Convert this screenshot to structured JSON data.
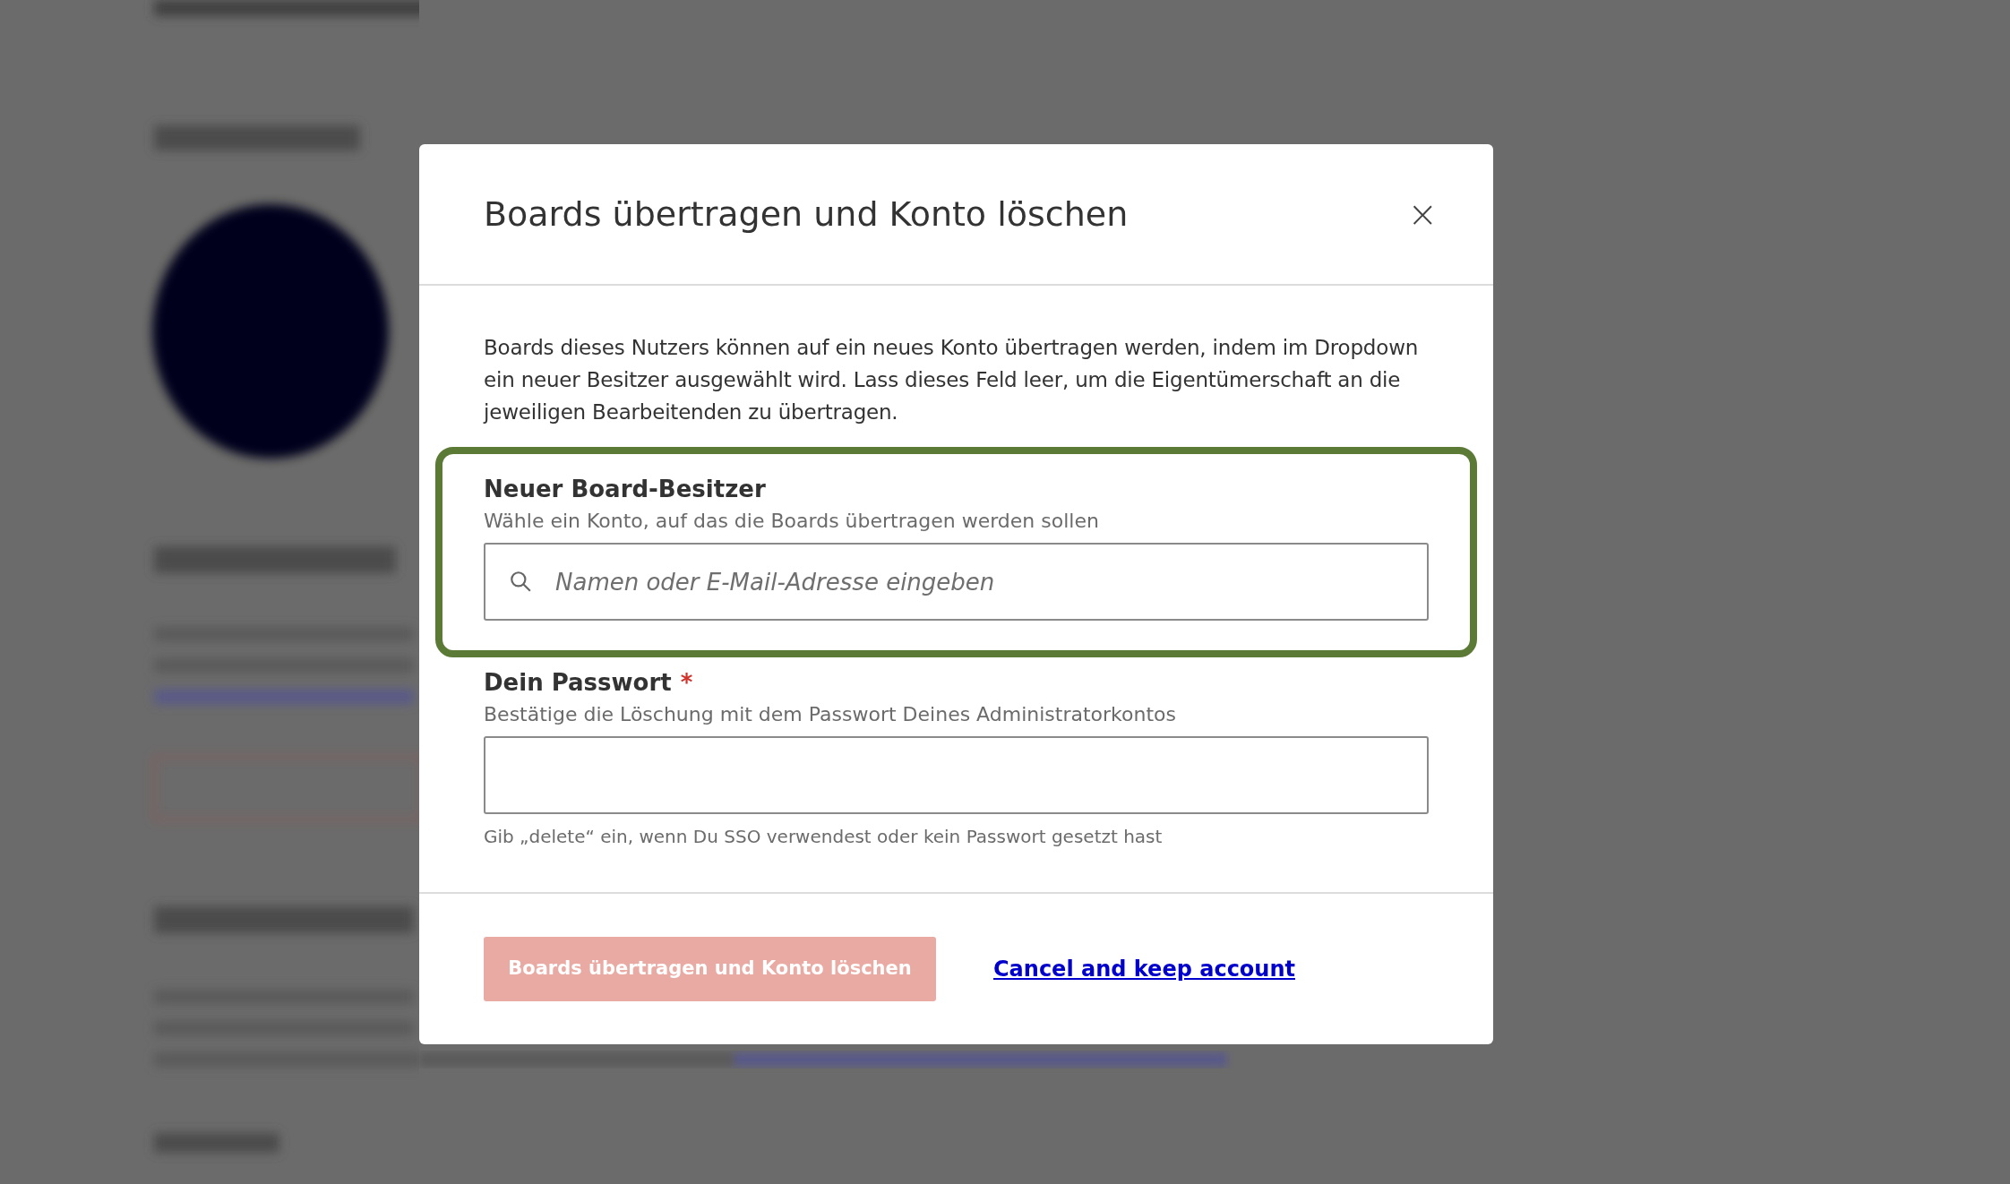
{
  "dialog": {
    "title": "Boards übertragen und Konto löschen",
    "close_label": "×",
    "description": "Boards dieses Nutzers können auf ein neues Konto übertragen werden, indem im Dropdown ein neuer Besitzer ausgewählt wird. Lass dieses Feld leer, um die Eigentümerschaft an die jeweiligen Bearbeitenden zu übertragen.",
    "fields": [
      {
        "kind": "search",
        "label": "Neuer Board-Besitzer",
        "highlighted": true,
        "help": "Wähle ein Konto, auf das die Boards übertragen werden sollen",
        "placeholder": "Namen oder E-Mail-Adresse eingeben"
      },
      {
        "kind": "password",
        "label": "Dein Passwort",
        "required_mark": "*",
        "highlighted": false,
        "help": "Bestätige die Löschung mit dem Passwort Deines Administratorkontos",
        "hint": "Gib „delete“ ein, wenn Du SSO verwendest oder kein Passwort gesetzt hast"
      }
    ],
    "submit": {
      "label": "Boards übertragen und Konto löschen",
      "disabled": true
    },
    "cancel": {
      "label": "Cancel and keep account"
    }
  }
}
